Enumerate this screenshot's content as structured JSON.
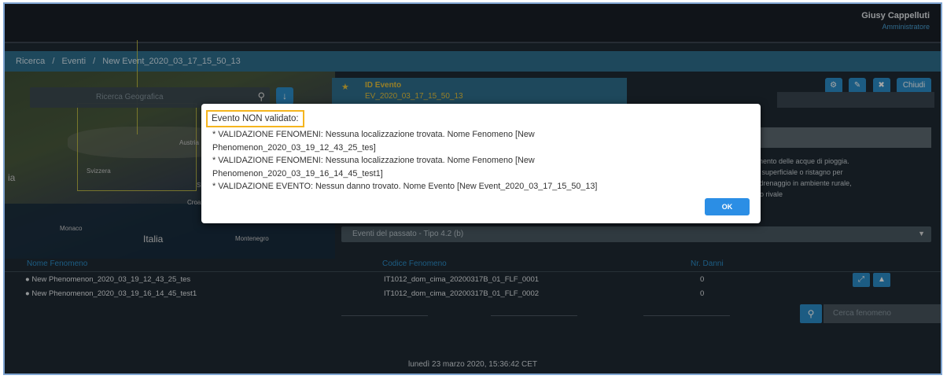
{
  "user": {
    "name": "Giusy Cappelluti",
    "role": "Amministratore"
  },
  "breadcrumb": [
    "Ricerca",
    "/",
    "Eventi",
    "/",
    "New Event_2020_03_17_15_50_13"
  ],
  "map": {
    "search_placeholder": "Ricerca Geografica",
    "labels": {
      "austria": "Austria",
      "svizzera": "Svizzera",
      "slovenia": "Slovenia",
      "croazia": "Croazia",
      "monaco": "Monaco",
      "montenegro": "Montenegro",
      "italia": "Italia",
      "ia": "ia"
    }
  },
  "event": {
    "label": "ID Evento",
    "id": "EV_2020_03_17_15_50_13"
  },
  "toolbar": {
    "chiudi": "Chiudi"
  },
  "description": [
    "...llamento delle acque di pioggia.",
    "...rito superficiale o ristagno per",
    "... di drenaggio in ambiente rurale,",
    "...ento rivale"
  ],
  "dropdown_value": "Eventi del passato - Tipo 4.2 (b)",
  "table": {
    "headers": {
      "name": "Nome Fenomeno",
      "code": "Codice Fenomeno",
      "danni": "Nr. Danni"
    },
    "rows": [
      {
        "name": "New Phenomenon_2020_03_19_12_43_25_tes",
        "code": "IT1012_dom_cima_20200317B_01_FLF_0001",
        "danni": "0"
      },
      {
        "name": "New Phenomenon_2020_03_19_16_14_45_test1",
        "code": "IT1012_dom_cima_20200317B_01_FLF_0002",
        "danni": "0"
      }
    ]
  },
  "search_phenomena_placeholder": "Cerca fenomeno",
  "footer": "lunedì 23 marzo 2020, 15:36:42 CET",
  "dialog": {
    "title": "Evento NON validato:",
    "lines": [
      "* VALIDAZIONE FENOMENI: Nessuna localizzazione trovata. Nome Fenomeno [New",
      "Phenomenon_2020_03_19_12_43_25_tes]",
      "* VALIDAZIONE FENOMENI: Nessuna localizzazione trovata. Nome Fenomeno [New",
      "Phenomenon_2020_03_19_16_14_45_test1]",
      "* VALIDAZIONE EVENTO: Nessun danno trovato. Nome Evento [New Event_2020_03_17_15_50_13]"
    ],
    "ok_label": "OK"
  },
  "colors": {
    "accent": "#2b8ee5",
    "highlight": "#f5b51e",
    "breadcrumb_bg": "#2f6f8e"
  }
}
